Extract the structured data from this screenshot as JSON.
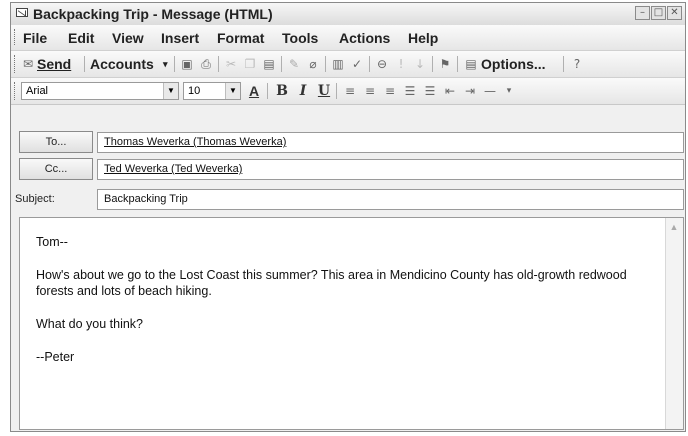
{
  "window": {
    "title": "Backpacking Trip - Message (HTML)",
    "controls": [
      "–",
      "□",
      "✕"
    ]
  },
  "menu": [
    "File",
    "Edit",
    "View",
    "Insert",
    "Format",
    "Tools",
    "Actions",
    "Help"
  ],
  "toolbar": {
    "send_label": "Send",
    "accounts_label": "Accounts",
    "options_label": "Options...",
    "icons": [
      "save-icon",
      "print-icon",
      "cut-icon",
      "copy-icon",
      "paste-icon",
      "spell-check-icon",
      "attach-icon",
      "address-book-icon",
      "check-names-icon",
      "permission-icon",
      "importance-high-icon",
      "importance-low-icon",
      "follow-up-flag-icon",
      "help-icon"
    ]
  },
  "format": {
    "font_name": "Arial",
    "font_size": "10",
    "buttons": [
      "A",
      "B",
      "I",
      "U"
    ]
  },
  "header": {
    "to_button": "To...",
    "to_value": "Thomas Weverka (Thomas Weverka)",
    "cc_button": "Cc...",
    "cc_value": "Ted Weverka (Ted Weverka)",
    "subject_label": "Subject:",
    "subject_value": "Backpacking Trip"
  },
  "message": {
    "greeting": "Tom--",
    "paragraph1": "How's about we go to the Lost Coast this summer? This area in Mendicino County has old-growth redwood forests and lots of beach hiking.",
    "paragraph2": "What do you think?",
    "signature": "--Peter"
  }
}
